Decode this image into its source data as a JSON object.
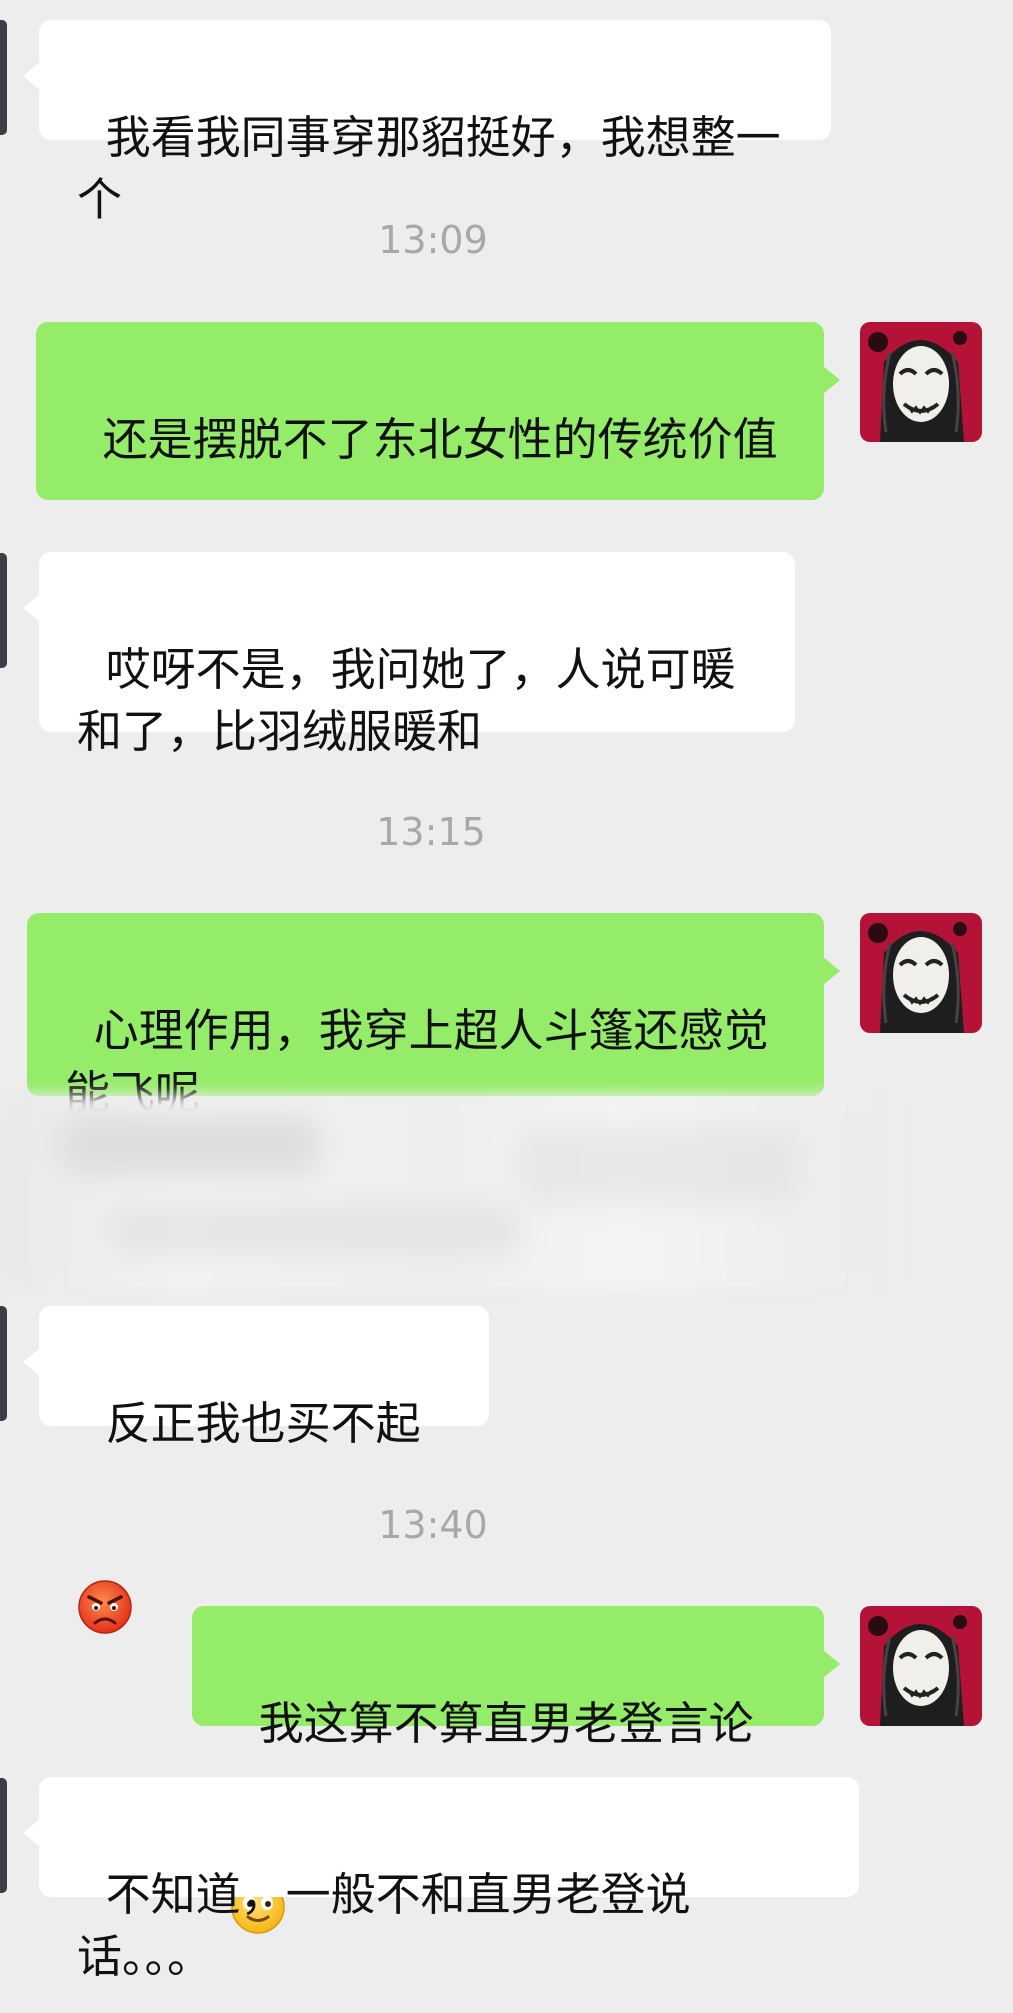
{
  "messages": [
    {
      "side": "in",
      "text": "我看我同事穿那貂挺好，我想整一个"
    },
    {
      "timestamp": "13:09"
    },
    {
      "side": "out",
      "text": "还是摆脱不了东北女性的传统价值认同么？"
    },
    {
      "side": "in",
      "text": "哎呀不是，我问她了，人说可暖和了，比羽绒服暖和"
    },
    {
      "timestamp": "13:15"
    },
    {
      "side": "out",
      "text": "心理作用，我穿上超人斗篷还感觉能飞呢"
    },
    {
      "side": "in",
      "text": "反正我也买不起"
    },
    {
      "timestamp": "13:40"
    },
    {
      "side": "out",
      "text": "我这算不算直男老登言论"
    },
    {
      "side": "in",
      "text": "不知道，一般不和直男老登说话。。。"
    }
  ],
  "emojis": {
    "smirk": "smirk-emoji",
    "angry": "angry-emoji",
    "smile": "smile-emoji"
  },
  "colors": {
    "background": "#ededed",
    "incoming_bubble": "#ffffff",
    "outgoing_bubble": "#95ec69",
    "timestamp_text": "#a8a8a8"
  }
}
